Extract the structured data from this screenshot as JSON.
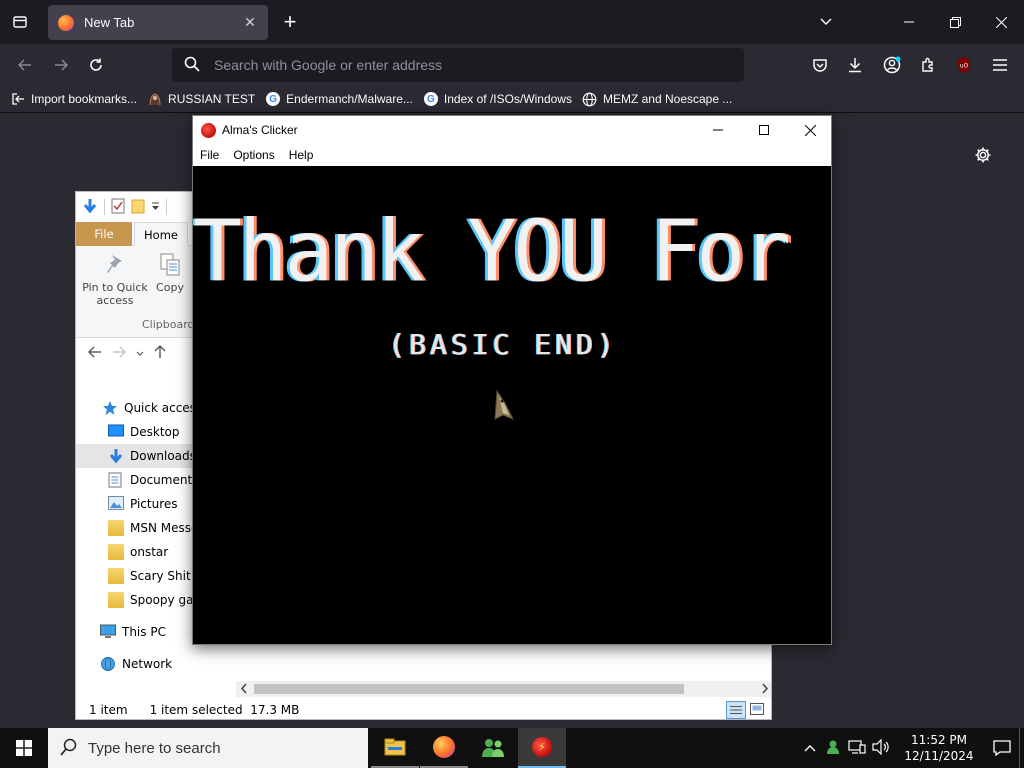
{
  "browser": {
    "tab_title": "New Tab",
    "url_placeholder": "Search with Google or enter address",
    "bookmarks": [
      {
        "label": "Import bookmarks...",
        "icon": "import-icon"
      },
      {
        "label": "RUSSIAN TEST",
        "icon": "russian-test-favicon"
      },
      {
        "label": "Endermanch/Malware...",
        "icon": "google-icon"
      },
      {
        "label": "Index of /ISOs/Windows",
        "icon": "google-icon"
      },
      {
        "label": "MEMZ and Noescape ...",
        "icon": "globe-icon"
      }
    ],
    "colors": {
      "tab_bg": "#42414d",
      "toolbar_bg": "#2b2a33",
      "frame_bg": "#1c1b22"
    }
  },
  "explorer": {
    "ribbon_tabs": [
      "File",
      "Home"
    ],
    "ribbon_buttons": {
      "pin": "Pin to Quick access",
      "copy": "Copy"
    },
    "group_label": "Clipboard",
    "nav_items": [
      {
        "label": "Quick access",
        "icon": "star-icon"
      },
      {
        "label": "Desktop",
        "icon": "desktop-icon"
      },
      {
        "label": "Downloads",
        "icon": "download-icon",
        "selected": true
      },
      {
        "label": "Documents",
        "icon": "documents-icon"
      },
      {
        "label": "Pictures",
        "icon": "pictures-icon"
      },
      {
        "label": "MSN Messe",
        "icon": "folder-icon"
      },
      {
        "label": "onstar",
        "icon": "folder-icon"
      },
      {
        "label": "Scary Shit",
        "icon": "folder-icon"
      },
      {
        "label": "Spoopy gam",
        "icon": "folder-icon"
      },
      {
        "label": "This PC",
        "icon": "pc-icon"
      },
      {
        "label": "Network",
        "icon": "network-icon"
      }
    ],
    "status": {
      "items": "1 item",
      "selected": "1 item selected",
      "size": "17.3 MB"
    }
  },
  "clicker": {
    "title": "Alma's Clicker",
    "menu": [
      "File",
      "Options",
      "Help"
    ],
    "heading": "Thank YOU For Playing!",
    "subheading": "(BASIC END)"
  },
  "taskbar": {
    "search_placeholder": "Type here to search",
    "apps": [
      "file-explorer-icon",
      "firefox-icon",
      "msn-messenger-icon",
      "alma-clicker-icon"
    ],
    "time": "11:52 PM",
    "date": "12/11/2024"
  }
}
